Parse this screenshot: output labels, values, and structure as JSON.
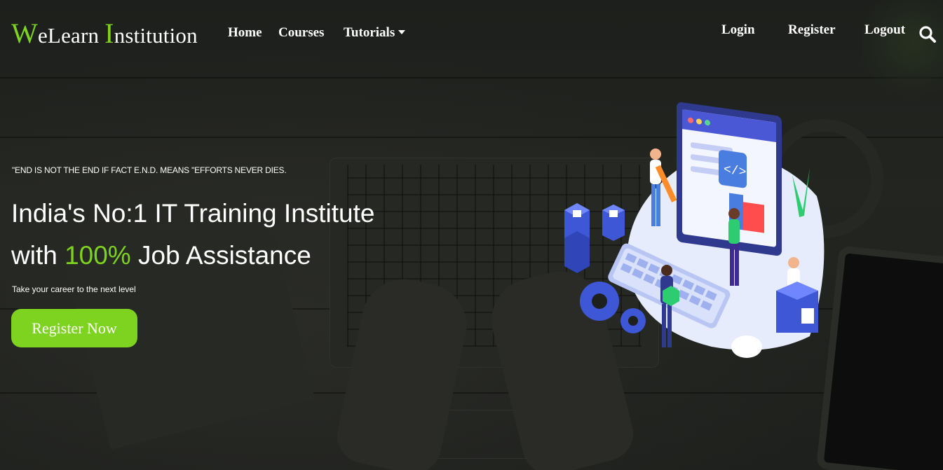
{
  "brand": {
    "first_initial": "W",
    "first_rest": "eLearn ",
    "second_initial": "I",
    "second_rest": "nstitution"
  },
  "nav": {
    "left": [
      {
        "label": "Home"
      },
      {
        "label": "Courses"
      },
      {
        "label": "Tutorials"
      }
    ],
    "right": [
      {
        "label": "Login"
      },
      {
        "label": "Register"
      },
      {
        "label": "Logout"
      }
    ],
    "search_icon": "search-icon"
  },
  "hero": {
    "quote": "\"END IS NOT THE END IF FACT E.N.D. MEANS \"EFFORTS NEVER DIES.",
    "headline_line1": "India's No:1 IT Training Institute",
    "headline_line2_pre": "with ",
    "headline_line2_highlight": "100%",
    "headline_line2_post": " Job Assistance",
    "tagline": "Take your career to the next level",
    "cta_label": "Register Now"
  },
  "colors": {
    "accent": "#7ed321",
    "text": "#ffffff",
    "background": "#1e201d"
  }
}
